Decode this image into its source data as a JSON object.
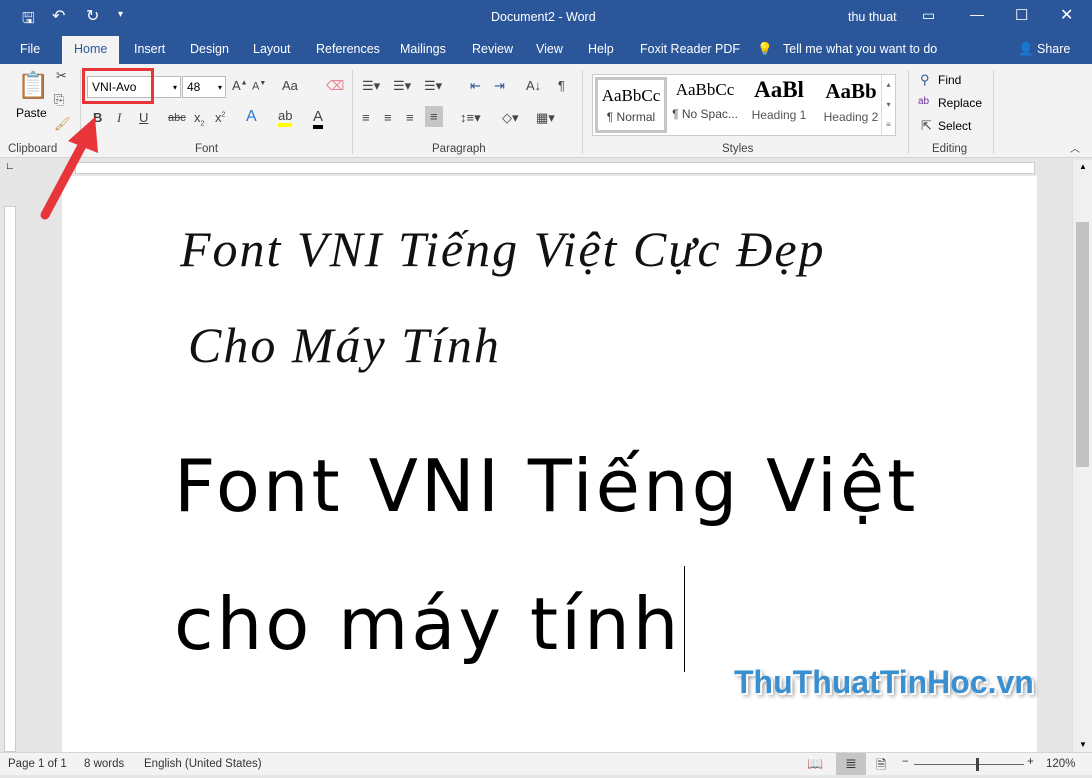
{
  "title": {
    "doc": "Document2 - Word",
    "user": "thu thuat"
  },
  "tabs": [
    "File",
    "Home",
    "Insert",
    "Design",
    "Layout",
    "References",
    "Mailings",
    "Review",
    "View",
    "Help",
    "Foxit Reader PDF"
  ],
  "tell_me": "Tell me what you want to do",
  "share": "Share",
  "clipboard": {
    "paste": "Paste",
    "label": "Clipboard"
  },
  "font": {
    "name": "VNI-Avo",
    "size": "48",
    "label": "Font",
    "change_case": "Aa"
  },
  "paragraph": {
    "label": "Paragraph"
  },
  "styles": {
    "label": "Styles",
    "items": [
      {
        "preview": "AaBbCc",
        "name": "¶ Normal"
      },
      {
        "preview": "AaBbCc",
        "name": "¶ No Spac..."
      },
      {
        "preview": "AaBl",
        "name": "Heading 1"
      },
      {
        "preview": "AaBb",
        "name": "Heading 2"
      }
    ]
  },
  "editing": {
    "label": "Editing",
    "find": "Find",
    "replace": "Replace",
    "select": "Select"
  },
  "document": {
    "lines": [
      "Font VNI Tiếng Việt Cực Đẹp",
      "Cho Máy Tính",
      "Font VNI Tiếng Việt",
      "cho máy tính"
    ]
  },
  "watermark": "ThuThuatTinHoc.vn",
  "status": {
    "page": "Page 1 of 1",
    "words": "8 words",
    "language": "English (United States)",
    "zoom": "120%"
  },
  "colors": {
    "accent": "#2b579a",
    "highlight_box": "#e8353a"
  }
}
